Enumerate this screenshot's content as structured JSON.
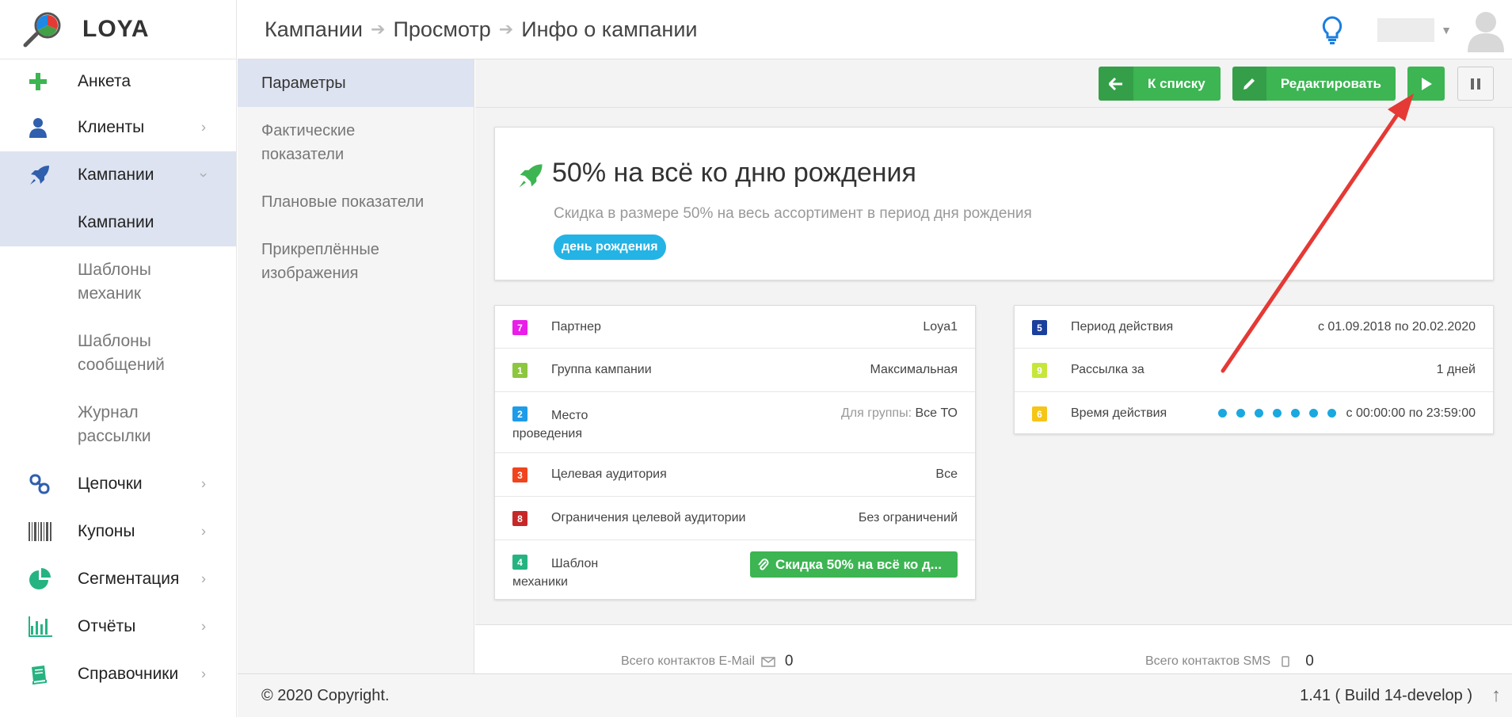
{
  "logo": {
    "text": "LOYA"
  },
  "sidebar": {
    "items": [
      {
        "label": "Анкета",
        "icon": "plus-icon"
      },
      {
        "label": "Клиенты",
        "icon": "user-icon"
      },
      {
        "label": "Кампании",
        "icon": "rocket-icon"
      },
      {
        "label": "Цепочки",
        "icon": "chain-icon"
      },
      {
        "label": "Купоны",
        "icon": "barcode-icon"
      },
      {
        "label": "Сегментация",
        "icon": "pie-icon"
      },
      {
        "label": "Отчёты",
        "icon": "chart-icon"
      },
      {
        "label": "Справочники",
        "icon": "book-icon"
      }
    ],
    "sub": [
      "Кампании",
      "Шаблоны механик",
      "Шаблоны сообщений",
      "Журнал рассылки"
    ]
  },
  "breadcrumb": [
    "Кампании",
    "Просмотр",
    "Инфо о кампании"
  ],
  "subnav": [
    "Параметры",
    "Фактические показатели",
    "Плановые показатели",
    "Прикреплённые изображения"
  ],
  "toolbar": {
    "back_label": "К списку",
    "edit_label": "Редактировать"
  },
  "campaign": {
    "title": "50% на всё ко дню рождения",
    "description": "Скидка в размере 50% на весь ассортимент в период дня рождения",
    "tag": "день рождения"
  },
  "params_left": [
    {
      "num": "7",
      "color": "#e91ee9",
      "label": "Партнер",
      "value": "Loya1"
    },
    {
      "num": "1",
      "color": "#8dc63f",
      "label": "Группа кампании",
      "value": "Максимальная"
    },
    {
      "num": "2",
      "color": "#1e9be9",
      "label": "Место проведения",
      "value_prefix": "Для группы:",
      "value": "Все ТО"
    },
    {
      "num": "3",
      "color": "#f0441e",
      "label": "Целевая аудитория",
      "value": "Все"
    },
    {
      "num": "8",
      "color": "#c62828",
      "label": "Ограничения целевой аудитории",
      "value": "Без ограничений"
    },
    {
      "num": "4",
      "color": "#26b382",
      "label": "Шаблон механики",
      "value": "Скидка 50% на всё ко д..."
    }
  ],
  "params_right": [
    {
      "num": "5",
      "color": "#1a3f9c",
      "label": "Период действия",
      "value": "с 01.09.2018 по 20.02.2020"
    },
    {
      "num": "9",
      "color": "#c6e63c",
      "label": "Рассылка за",
      "value": "1 дней"
    },
    {
      "num": "6",
      "color": "#f5c518",
      "label": "Время действия",
      "value": "с 00:00:00 по 23:59:00"
    }
  ],
  "stats": {
    "email_label": "Всего контактов E-Mail",
    "email_value": "0",
    "sms_label": "Всего контактов SMS",
    "sms_value": "0"
  },
  "footer": {
    "copyright": "© 2020 Copyright.",
    "build": "1.41 ( Build 14-develop )"
  },
  "colors": {
    "accent_green": "#3cb552",
    "tag_blue": "#24b3e5",
    "active_bg": "#dde3f0",
    "annotation_arrow": "#e53935"
  }
}
